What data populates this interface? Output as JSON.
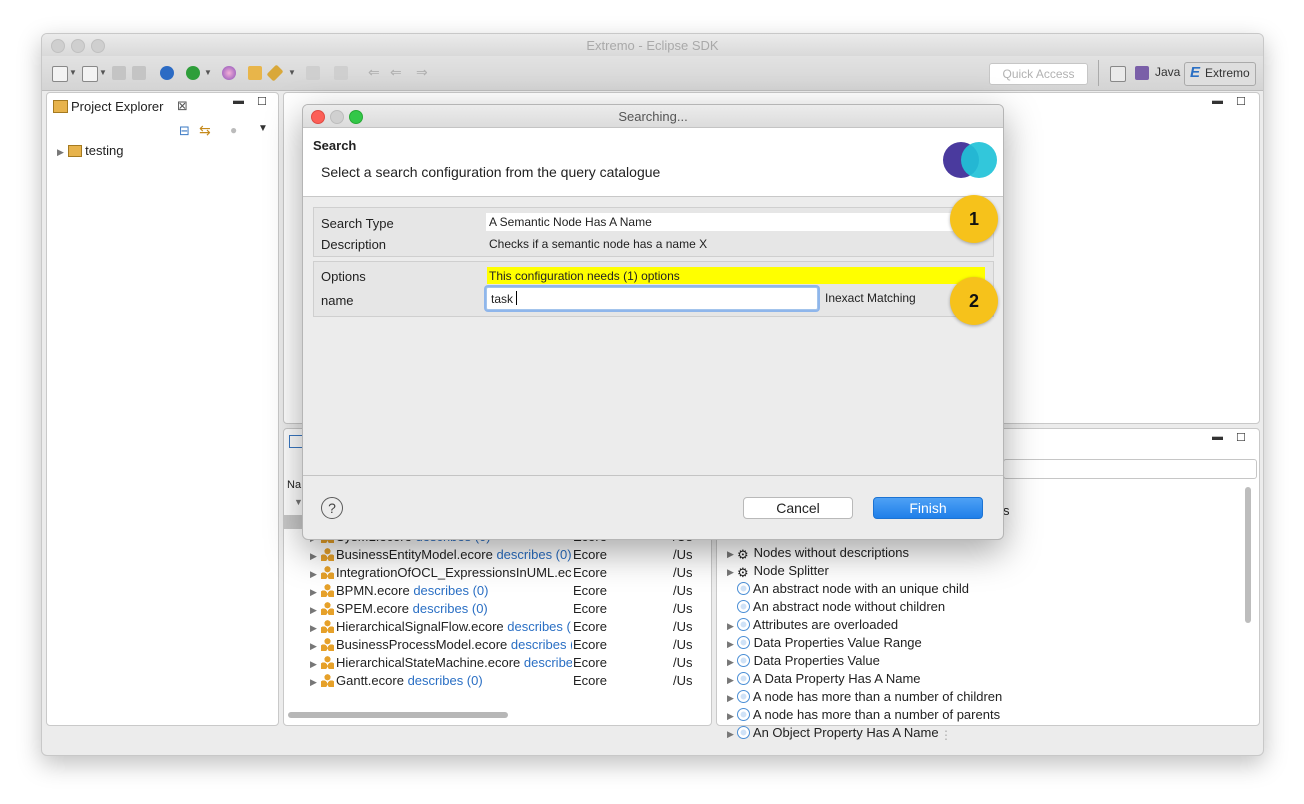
{
  "window": {
    "title": "Extremo - Eclipse SDK"
  },
  "toolbar": {
    "quick_access_placeholder": "Quick Access",
    "perspectives": [
      "Java",
      "Extremo"
    ]
  },
  "project_explorer": {
    "tab_label": "Project Explorer",
    "items": [
      {
        "label": "testing"
      }
    ]
  },
  "resources_view": {
    "column_header_partial": "Na",
    "rows": [
      {
        "name": "SysML.ecore",
        "describes": "describes (0)",
        "type": "Ecore",
        "path": "/Us"
      },
      {
        "name": "BusinessEntityModel.ecore",
        "describes": "describes (0)",
        "type": "Ecore",
        "path": "/Us"
      },
      {
        "name": "IntegrationOfOCL_ExpressionsInUML.ecore",
        "describes": "",
        "type": "Ecore",
        "path": "/Us"
      },
      {
        "name": "BPMN.ecore",
        "describes": "describes (0)",
        "type": "Ecore",
        "path": "/Us"
      },
      {
        "name": "SPEM.ecore",
        "describes": "describes (0)",
        "type": "Ecore",
        "path": "/Us"
      },
      {
        "name": "HierarchicalSignalFlow.ecore",
        "describes": "describes (",
        "type": "Ecore",
        "path": "/Us"
      },
      {
        "name": "BusinessProcessModel.ecore",
        "describes": "describes (",
        "type": "Ecore",
        "path": "/Us"
      },
      {
        "name": "HierarchicalStateMachine.ecore",
        "describes": "describe",
        "type": "Ecore",
        "path": "/Us"
      },
      {
        "name": "Gantt.ecore",
        "describes": "describes (0)",
        "type": "Ecore",
        "path": "/Us"
      }
    ]
  },
  "query_catalogue": {
    "items": [
      {
        "label": "Nodes without descriptions",
        "icon": "gear-icon",
        "expandable": true
      },
      {
        "label": "Node Splitter",
        "icon": "gear-icon",
        "expandable": true
      },
      {
        "label": "An abstract node with an unique child",
        "icon": "node-icon",
        "expandable": false
      },
      {
        "label": "An abstract node without children",
        "icon": "node-icon",
        "expandable": false
      },
      {
        "label": "Attributes are overloaded",
        "icon": "node-icon",
        "expandable": true
      },
      {
        "label": "Data Properties Value Range",
        "icon": "node-icon",
        "expandable": true
      },
      {
        "label": "Data Properties Value",
        "icon": "node-icon",
        "expandable": true
      },
      {
        "label": "A Data Property Has A Name",
        "icon": "node-icon",
        "expandable": true
      },
      {
        "label": "A node has more than a number of children",
        "icon": "node-icon",
        "expandable": true
      },
      {
        "label": "A node has more than a number of parents",
        "icon": "node-icon",
        "expandable": true
      },
      {
        "label": "An Object Property Has A Name",
        "icon": "node-icon",
        "expandable": true
      }
    ]
  },
  "dialog": {
    "title": "Searching...",
    "heading": "Search",
    "subtitle": "Select a search configuration from the query catalogue",
    "search_type_label": "Search Type",
    "search_type_value": "A Semantic Node Has A Name",
    "description_label": "Description",
    "description_value": "Checks if a semantic node has a name X",
    "options_label": "Options",
    "options_notice": "This configuration needs (1) options",
    "name_label": "name",
    "name_value": "task",
    "matching_value": "Inexact Matching",
    "cancel_label": "Cancel",
    "finish_label": "Finish",
    "help_label": "?"
  },
  "annotations": {
    "badge_1": "1",
    "badge_2": "2"
  },
  "colors": {
    "finish_button": "#2d8cf0",
    "notice_highlight": "#ffff00",
    "badge": "#f6c21b",
    "link_blue": "#2a6fc4"
  }
}
